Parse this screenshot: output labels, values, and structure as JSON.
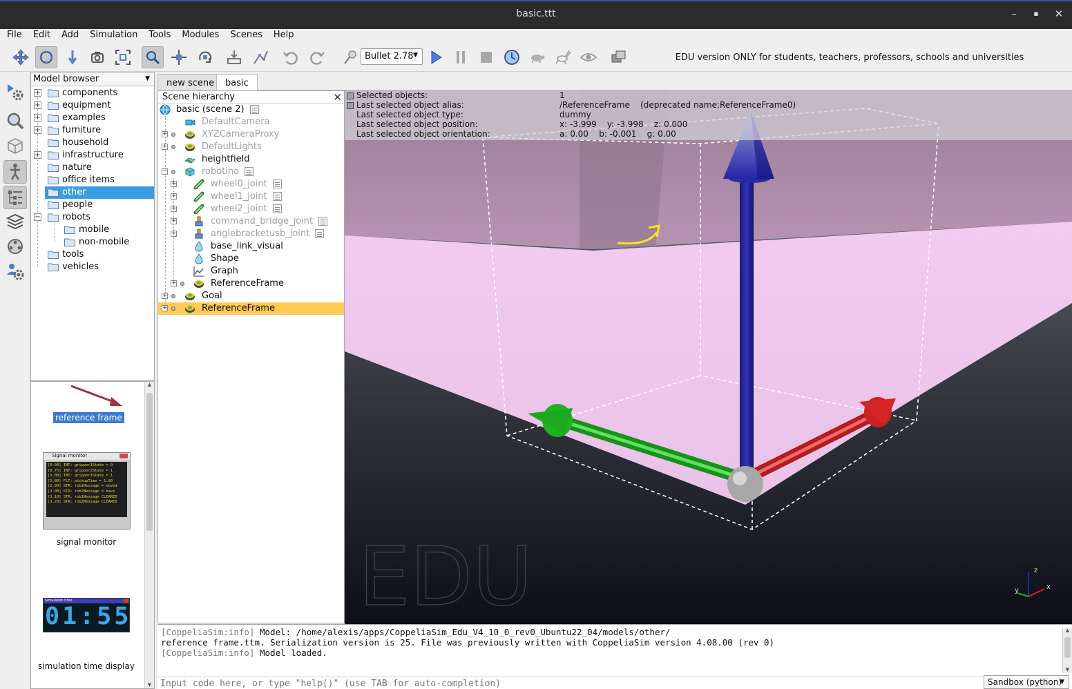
{
  "window": {
    "title": "basic.ttt",
    "minimize": "–",
    "maximize": "▪",
    "close": "✕"
  },
  "menu": [
    "File",
    "Edit",
    "Add",
    "Simulation",
    "Tools",
    "Modules",
    "Scenes",
    "Help"
  ],
  "toolbar": {
    "engine": "Bullet 2.78",
    "edu_note": "EDU version ONLY for students, teachers, professors, schools and universities"
  },
  "model_browser": {
    "title": "Model browser",
    "items": [
      {
        "label": "components",
        "expandable": true
      },
      {
        "label": "equipment",
        "expandable": true
      },
      {
        "label": "examples",
        "expandable": true
      },
      {
        "label": "furniture",
        "expandable": true
      },
      {
        "label": "household",
        "expandable": false
      },
      {
        "label": "infrastructure",
        "expandable": true
      },
      {
        "label": "nature",
        "expandable": false
      },
      {
        "label": "office items",
        "expandable": false
      },
      {
        "label": "other",
        "expandable": false,
        "selected": true
      },
      {
        "label": "people",
        "expandable": false
      },
      {
        "label": "robots",
        "expandable": true,
        "expanded": true
      },
      {
        "label": "mobile",
        "child": true
      },
      {
        "label": "non-mobile",
        "child": true
      },
      {
        "label": "tools",
        "expandable": false
      },
      {
        "label": "vehicles",
        "expandable": false
      }
    ]
  },
  "thumbnails": {
    "reference_frame": "reference frame",
    "signal_monitor": "signal monitor",
    "signal_monitor_title": "Signal monitor",
    "signal_monitor_lines": [
      "[0.00] INT: gripper1State = 0",
      "[0.75] INT: gripper2State = 1",
      "[1.00] INT: gripper1State = 1",
      "[1.80] FLT: pickupTime = 1.80",
      "[2.90] STR: rob1Message = moved",
      "[3.00] STR: rob2Message = have",
      "[3.10] STR: rob1Message CLEARED",
      "[3.20] STR: rob2Message CLEARED"
    ],
    "sim_time_title": "Simulation time",
    "sim_time_value": "01:55",
    "sim_time": "simulation time display"
  },
  "tabs": [
    {
      "label": "new scene",
      "active": false
    },
    {
      "label": "basic",
      "active": true
    }
  ],
  "hierarchy": {
    "title": "Scene hierarchy",
    "close": "✕",
    "rows": [
      {
        "label": "basic (scene 2)",
        "icon": "globe-icon",
        "dim": false
      },
      {
        "label": "DefaultCamera",
        "icon": "camera-icon",
        "dim": true
      },
      {
        "label": "XYZCameraProxy",
        "icon": "dummy-icon",
        "dim": true
      },
      {
        "label": "DefaultLights",
        "icon": "dummy-icon",
        "dim": true
      },
      {
        "label": "heightfield",
        "icon": "heightfield-icon",
        "dim": false
      },
      {
        "label": "robotino",
        "icon": "cube-icon",
        "dim": true
      },
      {
        "label": "wheel0_joint",
        "icon": "joint-icon",
        "dim": true
      },
      {
        "label": "wheel1_joint",
        "icon": "joint-icon",
        "dim": true
      },
      {
        "label": "wheel2_joint",
        "icon": "joint-icon",
        "dim": true
      },
      {
        "label": "command_bridge_joint",
        "icon": "prismatic-joint-icon",
        "dim": true
      },
      {
        "label": "anglebracketusb_joint",
        "icon": "prismatic-joint-icon",
        "dim": true
      },
      {
        "label": "base_link_visual",
        "icon": "shape-icon",
        "dim": false
      },
      {
        "label": "Shape",
        "icon": "shape-icon",
        "dim": false
      },
      {
        "label": "Graph",
        "icon": "graph-icon",
        "dim": false
      },
      {
        "label": "ReferenceFrame",
        "icon": "dummy-icon",
        "dim": false
      },
      {
        "label": "Goal",
        "icon": "dummy-icon",
        "dim": false
      },
      {
        "label": "ReferenceFrame",
        "icon": "dummy-icon",
        "dim": false,
        "selected": true
      }
    ]
  },
  "viewport": {
    "info": [
      {
        "label": "Selected objects:",
        "value": "1"
      },
      {
        "label": "Last selected object alias:",
        "value": "/ReferenceFrame    (deprecated name:ReferenceFrame0)"
      },
      {
        "label": "Last selected object type:",
        "value": "dummy"
      },
      {
        "label": "Last selected object position:",
        "value": "x: -3.999    y: -3.998    z: 0.000"
      },
      {
        "label": "Last selected object orientation:",
        "value": "a: 0.00    b: -0.001    g: 0.00"
      }
    ],
    "watermark": "EDU",
    "axis_labels": {
      "x": "x",
      "y": "y",
      "z": "z"
    },
    "colors": {
      "x_axis": "#d42424",
      "y_axis": "#1fb51f",
      "z_axis": "#1a1aa8",
      "floor": "#f0c8ef"
    }
  },
  "console": {
    "lines": [
      {
        "tag": "[CoppeliaSim:info]",
        "text": " Model: /home/alexis/apps/CoppeliaSim_Edu_V4_10_0_rev0_Ubuntu22_04/models/other/"
      },
      {
        "tag": "",
        "text": "reference frame.ttm. Serialization version is 25. File was previously written with CoppeliaSim version 4.08.00 (rev 0)"
      },
      {
        "tag": "[CoppeliaSim:info]",
        "text": " Model loaded."
      }
    ],
    "input_placeholder": "Input code here, or type \"help()\" (use TAB for auto-completion)",
    "sandbox": "Sandbox (python)"
  }
}
